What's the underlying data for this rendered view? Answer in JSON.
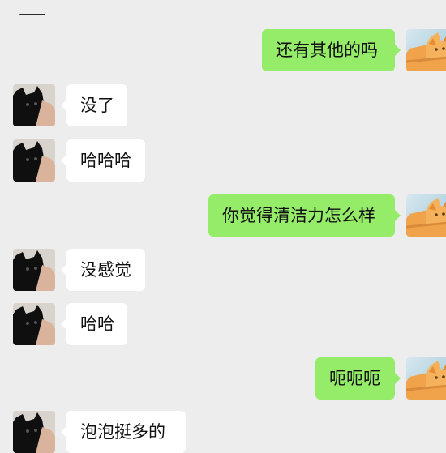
{
  "messages": [
    {
      "side": "right",
      "text": "还有其他的吗",
      "avatar": "orange-cat-avatar"
    },
    {
      "side": "left",
      "text": "没了",
      "avatar": "black-cat-avatar"
    },
    {
      "side": "left",
      "text": "哈哈哈",
      "avatar": "black-cat-avatar"
    },
    {
      "side": "right",
      "text": "你觉得清洁力怎么样",
      "avatar": "orange-cat-avatar"
    },
    {
      "side": "left",
      "text": "没感觉",
      "avatar": "black-cat-avatar"
    },
    {
      "side": "left",
      "text": "哈哈",
      "avatar": "black-cat-avatar"
    },
    {
      "side": "right",
      "text": "呃呃呃",
      "avatar": "orange-cat-avatar"
    },
    {
      "side": "left",
      "text": "泡泡挺多的",
      "avatar": "black-cat-avatar"
    }
  ],
  "colors": {
    "background": "#ededed",
    "outgoing_bubble": "#95ec69",
    "incoming_bubble": "#ffffff",
    "text": "#111111"
  }
}
